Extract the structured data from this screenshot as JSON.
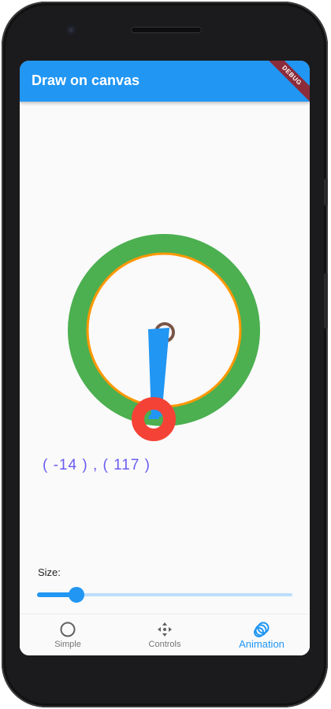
{
  "app": {
    "title": "Draw on canvas",
    "debug_banner": "DEBUG",
    "accent_color": "#2196f3"
  },
  "canvas": {
    "coordinates_text": "( -14 ) , ( 117 )",
    "colors": {
      "outer_ring": "#4caf50",
      "inner_ring": "#ff9800",
      "hand": "#2196f3",
      "pivot_ring": "#795548",
      "tip_circle": "#f44336"
    }
  },
  "controls": {
    "size_label": "Size:",
    "slider_value_fraction": 0.13
  },
  "bottom_nav": {
    "items": [
      {
        "label": "Simple",
        "icon": "circle-outline-icon",
        "active": false
      },
      {
        "label": "Controls",
        "icon": "move-arrows-icon",
        "active": false
      },
      {
        "label": "Animation",
        "icon": "animation-icon",
        "active": true
      }
    ]
  }
}
